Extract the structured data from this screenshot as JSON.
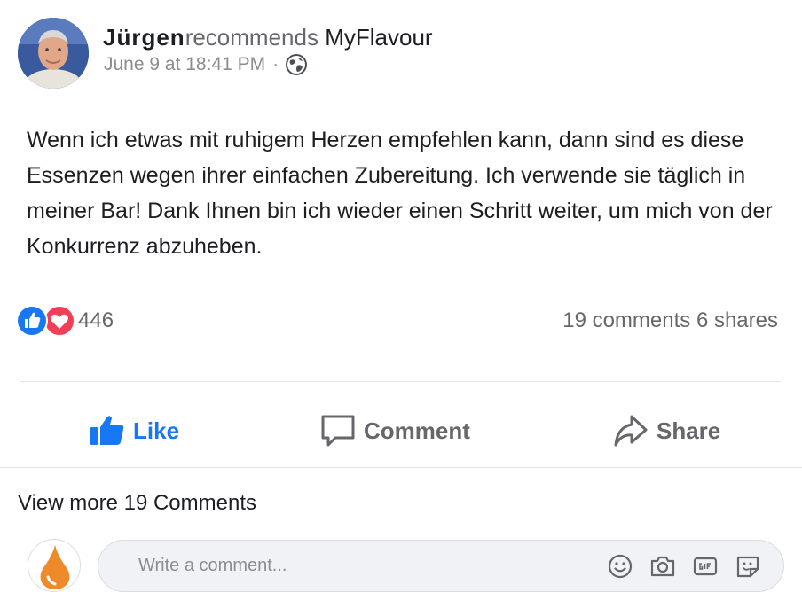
{
  "post": {
    "author": "Jürgen",
    "action": "recommends",
    "page": "MyFlavour",
    "timestamp": "June 9 at 18:41 PM",
    "separator": "·",
    "privacy_icon": "globe-icon",
    "body": "Wenn ich etwas mit ruhigem Herzen empfehlen kann, dann sind es diese Essenzen wegen ihrer einfachen Zubereitung. Ich verwende sie täglich in meiner Bar! Dank Ihnen bin ich wieder einen Schritt weiter, um mich von der Konkurrenz abzuheben."
  },
  "stats": {
    "reaction_icons": [
      "like-reaction-icon",
      "love-reaction-icon"
    ],
    "reaction_count": "446",
    "comments_shares": "19 comments 6 shares"
  },
  "actions": {
    "like_label": "Like",
    "comment_label": "Comment",
    "share_label": "Share"
  },
  "comments": {
    "view_more": "View more 19 Comments",
    "input_placeholder": "Write a comment...",
    "tool_icons": [
      "emoji-icon",
      "camera-icon",
      "gif-icon",
      "sticker-icon"
    ]
  },
  "colors": {
    "brand_blue": "#1877f2",
    "love_red": "#f33e58",
    "muted_text": "#65676b",
    "commenter_drop_orange": "#ee8a2a"
  }
}
